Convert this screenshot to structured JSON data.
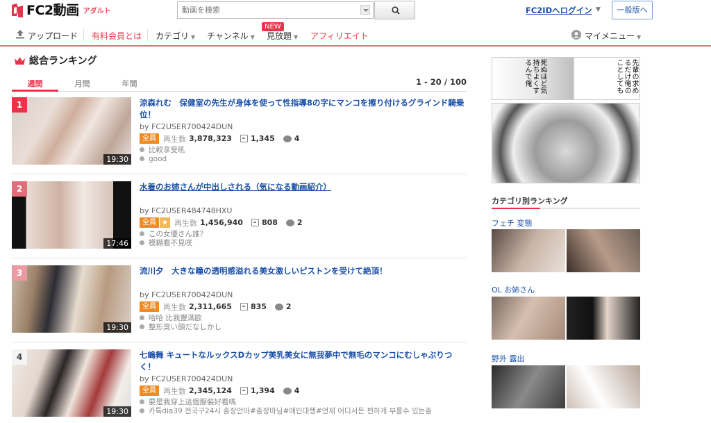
{
  "header": {
    "logo_text": "FC2動画",
    "logo_sub": "アダルト",
    "search_placeholder": "動画を検索",
    "login_label": "FC2IDへログイン",
    "general_label": "一般版へ"
  },
  "nav": {
    "upload": "アップロード",
    "paid": "有料会員とは",
    "category": "カテゴリ",
    "channel": "チャンネル",
    "unlimited": "見放題",
    "new_badge": "NEW",
    "affiliate": "アフィリエイト",
    "mymenu": "マイメニュー"
  },
  "ranking": {
    "title": "総合ランキング",
    "tabs": [
      "週間",
      "月間",
      "年間"
    ],
    "range": "1 - 20 / 100",
    "items": [
      {
        "rank": "1",
        "title": "涼森れむ　保健室の先生が身体を使って性指導8の字にマンコを擦り付けるグラインド騎乗位！",
        "user": "by FC2USER700424DUN",
        "badge": "全員",
        "views_label": "再生数",
        "views": "3,878,323",
        "favs": "1,345",
        "comments_count": "4",
        "duration": "19:30",
        "comments": [
          "比較享受吼",
          "good"
        ]
      },
      {
        "rank": "2",
        "title": "水着のお姉さんが中出しされる（気になる動画紹介）",
        "user": "by FC2USER484748HXU",
        "badge": "全員",
        "views_label": "再生数",
        "views": "1,456,940",
        "favs": "808",
        "comments_count": "2",
        "duration": "17:46",
        "comments": [
          "この女優さん誰？",
          "模糊看不見咲"
        ]
      },
      {
        "rank": "3",
        "title": "流川夕　大きな瞳の透明感溢れる美女激しいピストンを受けて絶頂！",
        "user": "by FC2USER700424DUN",
        "badge": "全員",
        "views_label": "再生数",
        "views": "2,311,665",
        "favs": "835",
        "comments_count": "2",
        "duration": "19:30",
        "comments": [
          "哈哈 比我豐滿歐",
          "整形臭い顔だなしかし"
        ]
      },
      {
        "rank": "4",
        "title": "七嶋舞 キュートなルックスDカップ美乳美女に無我夢中で無毛のマンコにむしゃぶりつく！",
        "user": "by FC2USER700424DUN",
        "badge": "全員",
        "views_label": "再生数",
        "views": "2,345,124",
        "favs": "1,394",
        "comments_count": "4",
        "duration": "19:30",
        "comments": [
          "要是我穿上這個服裝好看嗎",
          "카톡dia39 전국구24시 출장안마#출장마님#애인대행#언제 어디서든 편하게 부를수 있는출"
        ]
      }
    ]
  },
  "sidebar": {
    "ranking_title": "カテゴリ別ランキング",
    "categories": [
      "フェチ 変態",
      "OL お姉さん",
      "野外 露出"
    ],
    "manga_text_1": "先輩の求めるだけ俺のことしても",
    "manga_text_2": "死ぬほど気持ちよくするんで俺"
  },
  "colors": {
    "accent": "#e8334a",
    "link": "#1a4fa8",
    "badge_orange": "#f08b24"
  }
}
